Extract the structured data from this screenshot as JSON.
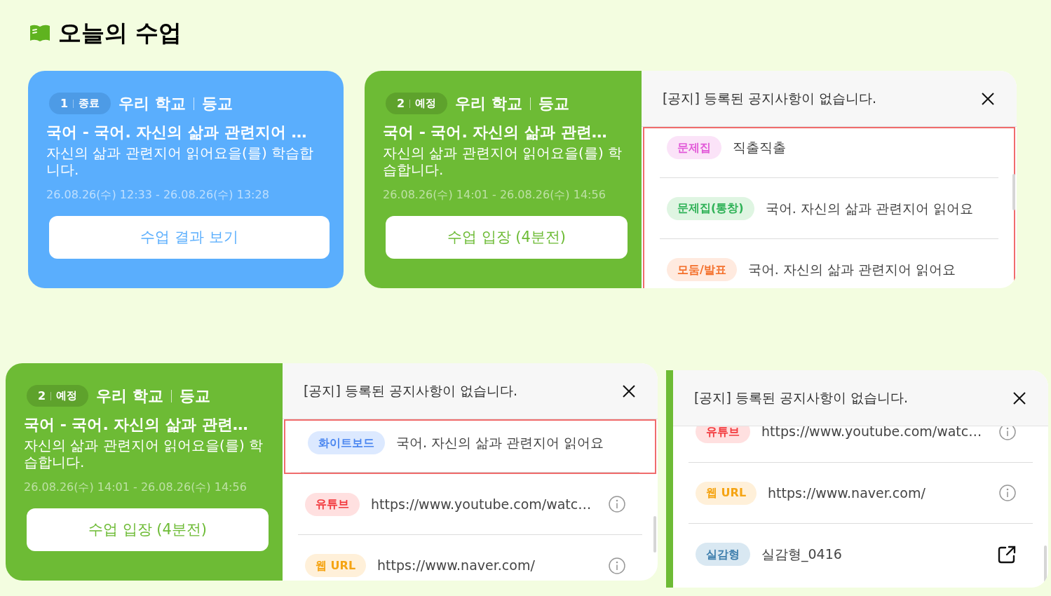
{
  "heading": "오늘의 수업",
  "lessons": [
    {
      "kind": "ended",
      "number": "1",
      "status_label": "종료",
      "school": "우리 학교",
      "type": "등교",
      "title": "국어 - 국어. 자신의 삶과 관련지어 …",
      "description": "자신의 삶과 관련지어 읽어요을(를) 학습합니다.",
      "time": "26.08.26(수) 12:33 - 26.08.26(수) 13:28",
      "button": "수업 결과 보기"
    },
    {
      "kind": "scheduled",
      "number": "2",
      "status_label": "예정",
      "school": "우리 학교",
      "type": "등교",
      "title": "국어 - 국어. 자신의 삶과 관련…",
      "description": "자신의 삶과 관련지어 읽어요을(를) 학습합니다.",
      "time": "26.08.26(수) 14:01 - 26.08.26(수) 14:56",
      "button": "수업 입장 (4분전)",
      "panel": {
        "notice": "[공지] 등록된 공지사항이 없습니다.",
        "items": [
          {
            "kind": "workbook",
            "tag": "문제집",
            "text": "직출직출",
            "highlighted": true
          },
          {
            "kind": "workbook_group",
            "tag": "문제집(통창)",
            "text": "국어. 자신의 삶과 관련지어 읽어요",
            "highlighted": true
          },
          {
            "kind": "group_presentation",
            "tag": "모둠/발표",
            "text": "국어. 자신의 삶과 관련지어 읽어요",
            "highlighted": true
          }
        ]
      }
    },
    {
      "kind": "scheduled",
      "number": "2",
      "status_label": "예정",
      "school": "우리 학교",
      "type": "등교",
      "title": "국어 - 국어. 자신의 삶과 관련…",
      "description": "자신의 삶과 관련지어 읽어요을(를) 학습합니다.",
      "time": "26.08.26(수) 14:01 - 26.08.26(수) 14:56",
      "button": "수업 입장 (4분전)",
      "panel": {
        "notice": "[공지] 등록된 공지사항이 없습니다.",
        "items": [
          {
            "kind": "whiteboard",
            "tag": "화이트보드",
            "text": "국어. 자신의 삶과 관련지어 읽어요",
            "highlighted": true
          },
          {
            "kind": "youtube",
            "tag": "유튜브",
            "text": "https://www.youtube.com/watc…",
            "highlighted": false
          },
          {
            "kind": "web_url",
            "tag": "웹 URL",
            "text": "https://www.naver.com/",
            "highlighted": false
          }
        ]
      }
    }
  ],
  "extra_panel": {
    "notice": "[공지] 등록된 공지사항이 없습니다.",
    "items": [
      {
        "kind": "youtube",
        "tag": "유튜브",
        "text": "https://www.youtube.com/watc…",
        "highlighted": false
      },
      {
        "kind": "web_url",
        "tag": "웹 URL",
        "text": "https://www.naver.com/",
        "highlighted": false
      },
      {
        "kind": "realistic",
        "tag": "실감형",
        "text": "실감형_0416",
        "highlighted": false
      }
    ]
  }
}
